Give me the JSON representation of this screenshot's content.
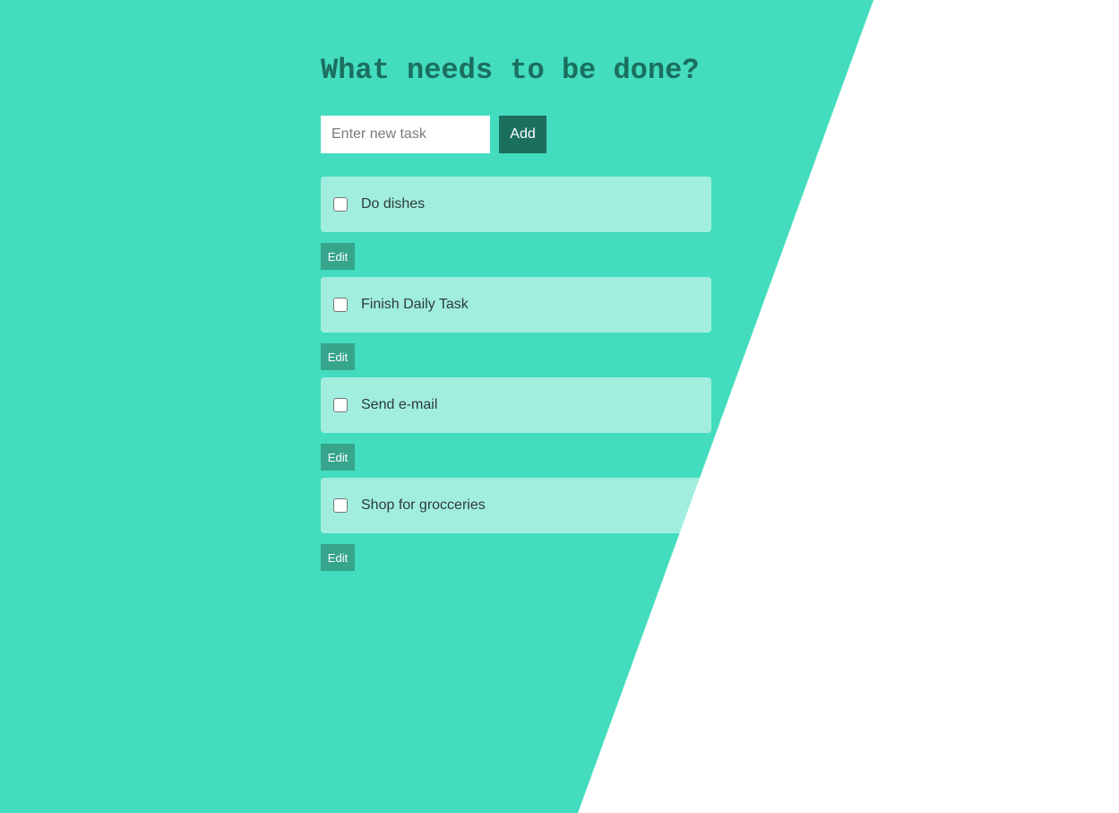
{
  "header": {
    "title": "What needs to be done?"
  },
  "form": {
    "placeholder": "Enter new task",
    "value": "",
    "add_label": "Add"
  },
  "tasks": [
    {
      "label": "Do dishes",
      "checked": false,
      "edit_label": "Edit"
    },
    {
      "label": "Finish Daily Task",
      "checked": false,
      "edit_label": "Edit"
    },
    {
      "label": "Send e-mail",
      "checked": false,
      "edit_label": "Edit"
    },
    {
      "label": "Shop for grocceries",
      "checked": false,
      "edit_label": "Edit"
    }
  ],
  "colors": {
    "background_accent": "#43dcbe",
    "title": "#1a6f5e",
    "add_button": "#1a6f5e",
    "edit_button": "#36a58c",
    "task_item": "#a2ede0"
  }
}
